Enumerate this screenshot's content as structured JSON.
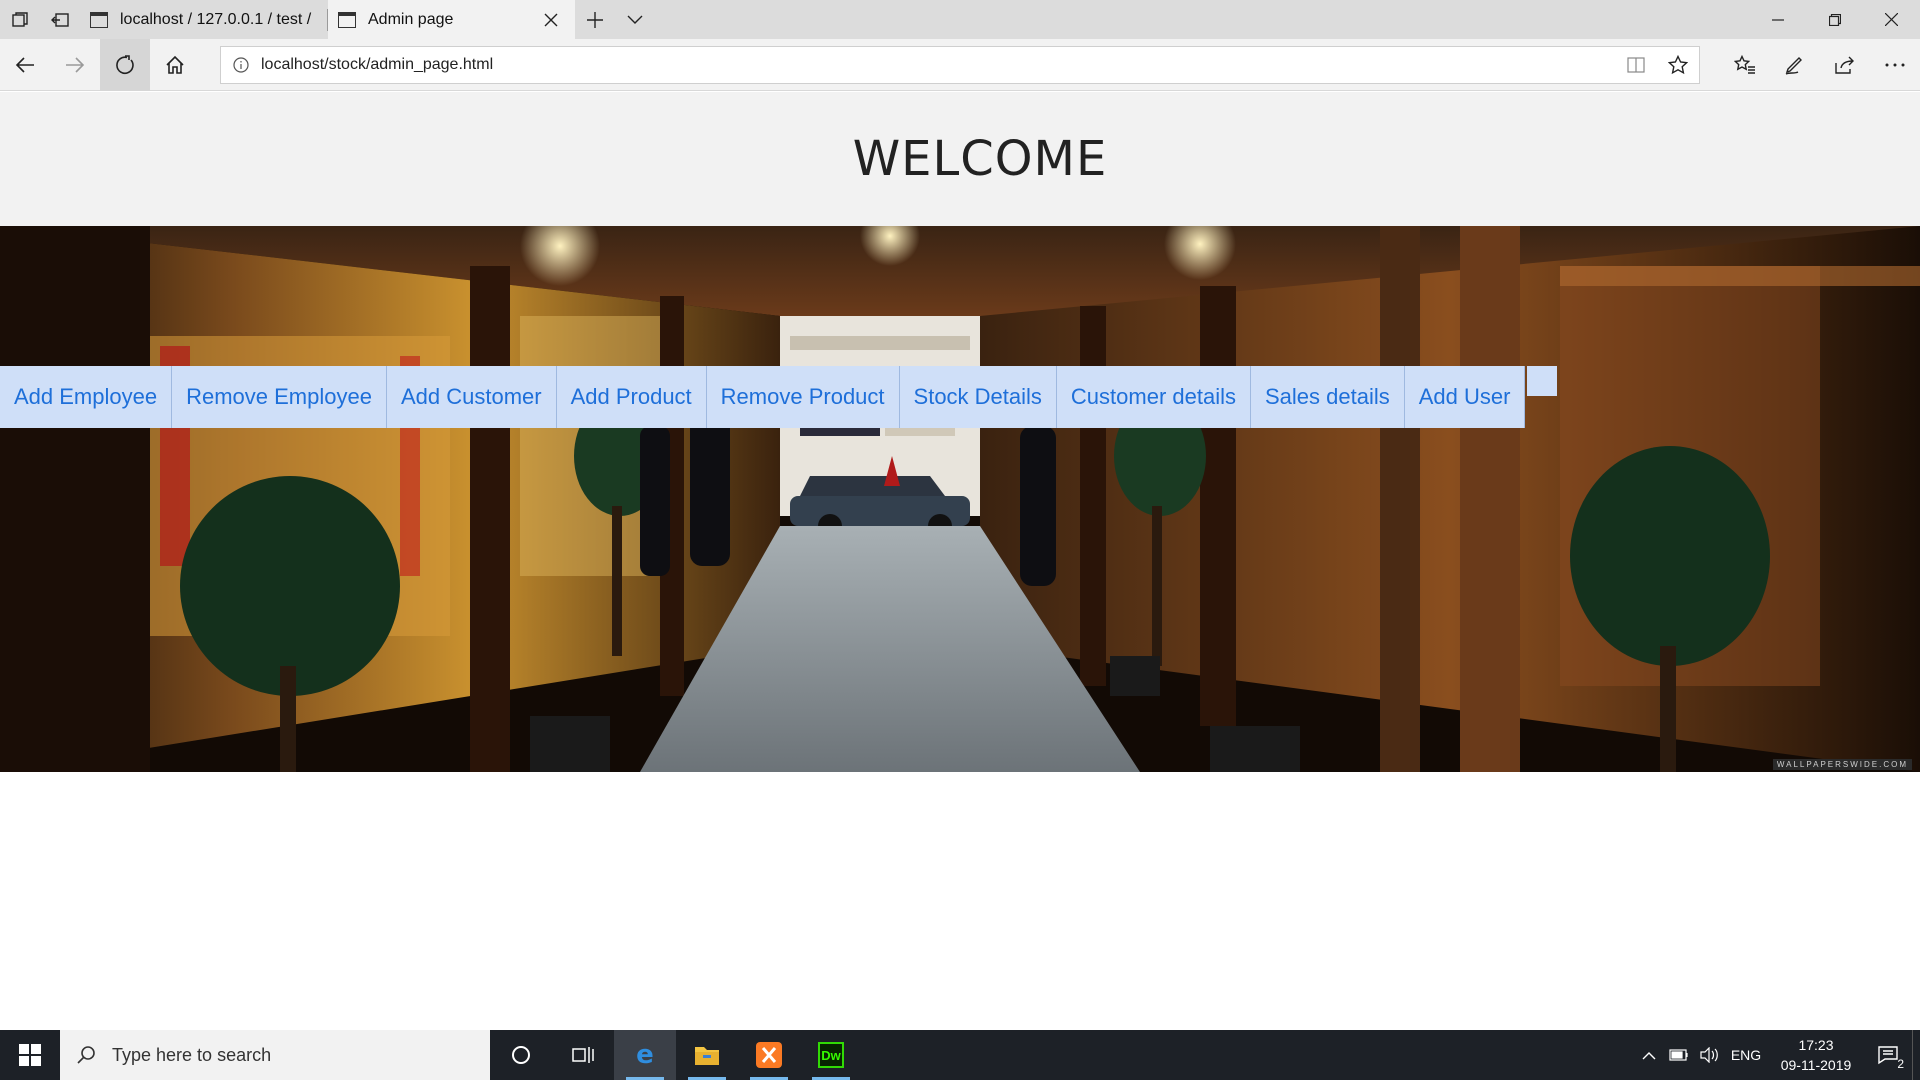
{
  "browser": {
    "tabs": [
      {
        "label": "localhost / 127.0.0.1 / test /",
        "active": false
      },
      {
        "label": "Admin page",
        "active": true
      }
    ],
    "address": "localhost/stock/admin_page.html"
  },
  "page": {
    "heading": "WELCOME",
    "menu": [
      "Add Employee",
      "Remove Employee",
      "Add Customer",
      "Add Product",
      "Remove Product",
      "Stock Details",
      "Customer details",
      "Sales details",
      "Add User"
    ],
    "hero_watermark": "WALLPAPERSWIDE.COM",
    "colors": {
      "menu_bg": "#cfdff8",
      "menu_text": "#1e6fd9",
      "header_bg": "#f2f2f2"
    }
  },
  "taskbar": {
    "search_placeholder": "Type here to search",
    "apps": [
      "cortana-icon",
      "task-view-icon",
      "edge-icon",
      "file-explorer-icon",
      "xampp-icon",
      "dreamweaver-icon"
    ],
    "dreamweaver_label": "Dw",
    "language": "ENG",
    "time": "17:23",
    "date": "09-11-2019",
    "notifications": "2"
  }
}
